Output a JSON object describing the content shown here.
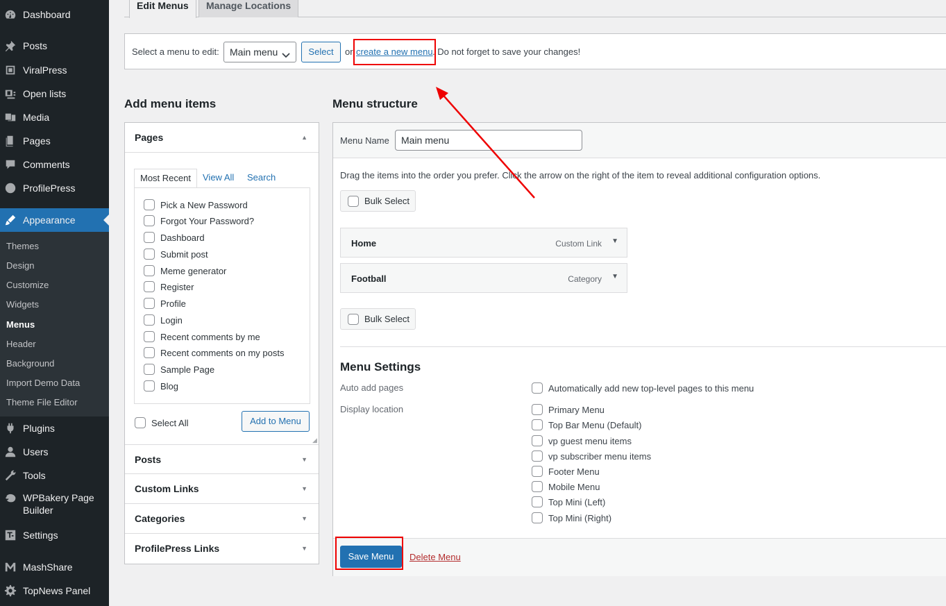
{
  "sidebar": {
    "items": [
      {
        "label": "Dashboard",
        "icon": "dashboard-icon"
      },
      {
        "label": "Posts",
        "icon": "pin-icon"
      },
      {
        "label": "ViralPress",
        "icon": "viralpress-icon"
      },
      {
        "label": "Open lists",
        "icon": "list-icon"
      },
      {
        "label": "Media",
        "icon": "media-icon"
      },
      {
        "label": "Pages",
        "icon": "pages-icon"
      },
      {
        "label": "Comments",
        "icon": "comment-icon"
      },
      {
        "label": "ProfilePress",
        "icon": "profilepress-icon"
      },
      {
        "label": "Appearance",
        "icon": "brush-icon"
      },
      {
        "label": "Plugins",
        "icon": "plugin-icon"
      },
      {
        "label": "Users",
        "icon": "user-icon"
      },
      {
        "label": "Tools",
        "icon": "wrench-icon"
      },
      {
        "label": "WPBakery Page",
        "label2": "Builder",
        "icon": "wpbakery-icon"
      },
      {
        "label": "Settings",
        "icon": "settings-icon"
      },
      {
        "label": "MashShare",
        "icon": "mashshare-icon"
      },
      {
        "label": "TopNews Panel",
        "icon": "gear-icon"
      }
    ],
    "submenu": [
      "Themes",
      "Design",
      "Customize",
      "Widgets",
      "Menus",
      "Header",
      "Background",
      "Import Demo Data",
      "Theme File Editor"
    ]
  },
  "tabs": {
    "edit": "Edit Menus",
    "manage": "Manage Locations"
  },
  "select_bar": {
    "label": "Select a menu to edit:",
    "selected": "Main menu",
    "select_button": "Select",
    "or": "or",
    "create_link": "create a new menu",
    "note": ". Do not forget to save your changes!"
  },
  "left": {
    "heading": "Add menu items",
    "pages_title": "Pages",
    "tabs": [
      "Most Recent",
      "View All",
      "Search"
    ],
    "pages": [
      "Pick a New Password",
      "Forgot Your Password?",
      "Dashboard",
      "Submit post",
      "Meme generator",
      "Register",
      "Profile",
      "Login",
      "Recent comments by me",
      "Recent comments on my posts",
      "Sample Page",
      "Blog"
    ],
    "select_all": "Select All",
    "add_button": "Add to Menu",
    "sections": [
      "Posts",
      "Custom Links",
      "Categories",
      "ProfilePress Links"
    ]
  },
  "right": {
    "heading": "Menu structure",
    "menu_name_label": "Menu Name",
    "menu_name_value": "Main menu",
    "drag_note": "Drag the items into the order you prefer. Click the arrow on the right of the item to reveal additional configuration options.",
    "bulk_select": "Bulk Select",
    "menu_items": [
      {
        "title": "Home",
        "type": "Custom Link"
      },
      {
        "title": "Football",
        "type": "Category"
      }
    ],
    "settings_title": "Menu Settings",
    "auto_add_label": "Auto add pages",
    "auto_add_option": "Automatically add new top-level pages to this menu",
    "display_location_label": "Display location",
    "locations": [
      "Primary Menu",
      "Top Bar Menu (Default)",
      "vp guest menu items",
      "vp subscriber menu items",
      "Footer Menu",
      "Mobile Menu",
      "Top Mini (Left)",
      "Top Mini (Right)"
    ],
    "save_button": "Save Menu",
    "delete_link": "Delete Menu"
  },
  "colors": {
    "accent": "#2271b1",
    "sidebar": "#1d2327",
    "highlight": "#ee0000"
  }
}
